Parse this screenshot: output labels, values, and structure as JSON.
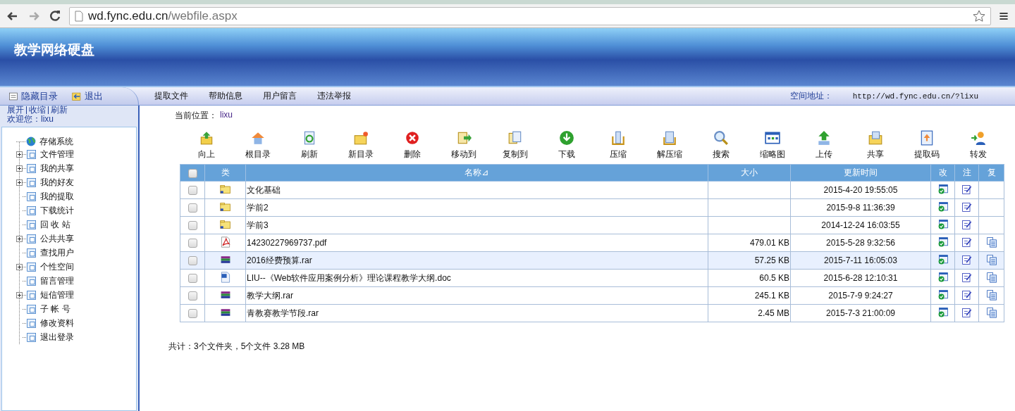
{
  "browser": {
    "url_host": "wd.fync.edu.cn",
    "url_path": "/webfile.aspx"
  },
  "banner": {
    "title": "教学网络硬盘"
  },
  "sidebar": {
    "buttons": [
      "隐藏目录",
      "退出"
    ],
    "links": [
      "展开",
      "收缩",
      "刷新"
    ],
    "welcome": "欢迎您：lixu",
    "tree": [
      {
        "label": "存储系统",
        "kind": "root",
        "children": [
          {
            "label": "文件管理",
            "kind": "branch"
          },
          {
            "label": "我的共享",
            "kind": "branch"
          },
          {
            "label": "我的好友",
            "kind": "branch"
          },
          {
            "label": "我的提取",
            "kind": "leaf"
          },
          {
            "label": "下载统计",
            "kind": "leaf"
          },
          {
            "label": "回 收 站",
            "kind": "leaf"
          },
          {
            "label": "公共共享",
            "kind": "branch"
          },
          {
            "label": "查找用户",
            "kind": "leaf"
          },
          {
            "label": "个性空间",
            "kind": "branch"
          },
          {
            "label": "留言管理",
            "kind": "leaf"
          },
          {
            "label": "短信管理",
            "kind": "branch"
          },
          {
            "label": "子 帐 号",
            "kind": "leaf"
          },
          {
            "label": "修改资料",
            "kind": "leaf"
          },
          {
            "label": "退出登录",
            "kind": "leaf"
          }
        ]
      }
    ]
  },
  "nav": {
    "items": [
      "提取文件",
      "帮助信息",
      "用户留言",
      "违法举报"
    ],
    "space_label": "空间地址：",
    "space_url": "http://wd.fync.edu.cn/?lixu"
  },
  "location": {
    "label": "当前位置：",
    "value": "lixu"
  },
  "toolbar": [
    "向上",
    "根目录",
    "刷新",
    "新目录",
    "删除",
    "移动到",
    "复制到",
    "下载",
    "压缩",
    "解压缩",
    "搜索",
    "缩略图",
    "上传",
    "共享",
    "提取码",
    "转发"
  ],
  "table": {
    "select_all_checked": false,
    "columns": [
      "类",
      "名称⊿",
      "大小",
      "更新时间",
      "改",
      "注",
      "复"
    ],
    "rows": [
      {
        "kind": "folder",
        "name": "文化基础",
        "size": "",
        "time": "2015-4-20 19:55:05",
        "checked": false,
        "selected": false
      },
      {
        "kind": "folder",
        "name": "学前2",
        "size": "",
        "time": "2015-9-8 11:36:39",
        "checked": false,
        "selected": false
      },
      {
        "kind": "folder",
        "name": "学前3",
        "size": "",
        "time": "2014-12-24 16:03:55",
        "checked": false,
        "selected": false
      },
      {
        "kind": "pdf",
        "name": "14230227969737.pdf",
        "size": "479.01 KB",
        "time": "2015-5-28 9:32:56",
        "checked": false,
        "selected": false
      },
      {
        "kind": "rar",
        "name": "2016经费预算.rar",
        "size": "57.25 KB",
        "time": "2015-7-11 16:05:03",
        "checked": false,
        "selected": true
      },
      {
        "kind": "doc",
        "name": "LIU--《Web软件应用案例分析》理论课程教学大纲.doc",
        "size": "60.5 KB",
        "time": "2015-6-28 12:10:31",
        "checked": false,
        "selected": false
      },
      {
        "kind": "rar",
        "name": "教学大纲.rar",
        "size": "245.1 KB",
        "time": "2015-7-9 9:24:27",
        "checked": false,
        "selected": false
      },
      {
        "kind": "rar",
        "name": "青教赛教学节段.rar",
        "size": "2.45 MB",
        "time": "2015-7-3 21:00:09",
        "checked": false,
        "selected": false
      }
    ]
  },
  "summary": "共计：3个文件夹，5个文件 3.28 MB"
}
